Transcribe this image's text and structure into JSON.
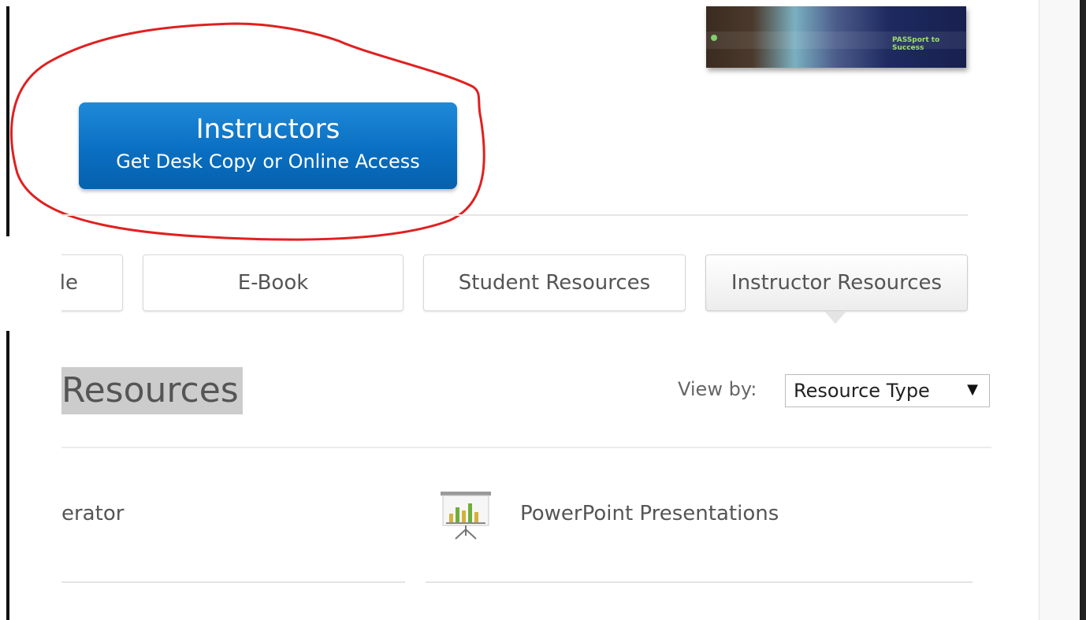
{
  "cover_image": {
    "alt": "Book cover banner",
    "badge_text": "PASSport to Success"
  },
  "cta": {
    "title": "Instructors",
    "subtitle": "Get Desk Copy or Online Access",
    "color": "#0a6fc2",
    "annotation_color": "#e02020"
  },
  "tabs": [
    {
      "label": "le",
      "active": false
    },
    {
      "label": "E-Book",
      "active": false
    },
    {
      "label": "Student Resources",
      "active": false
    },
    {
      "label": "Instructor Resources",
      "active": true
    }
  ],
  "section": {
    "heading": "Resources",
    "viewby_label": "View by:",
    "select_value": "Resource Type"
  },
  "resources": [
    {
      "label": "erator",
      "icon": "none"
    },
    {
      "label": "PowerPoint Presentations",
      "icon": "presentation-chart-icon"
    }
  ]
}
